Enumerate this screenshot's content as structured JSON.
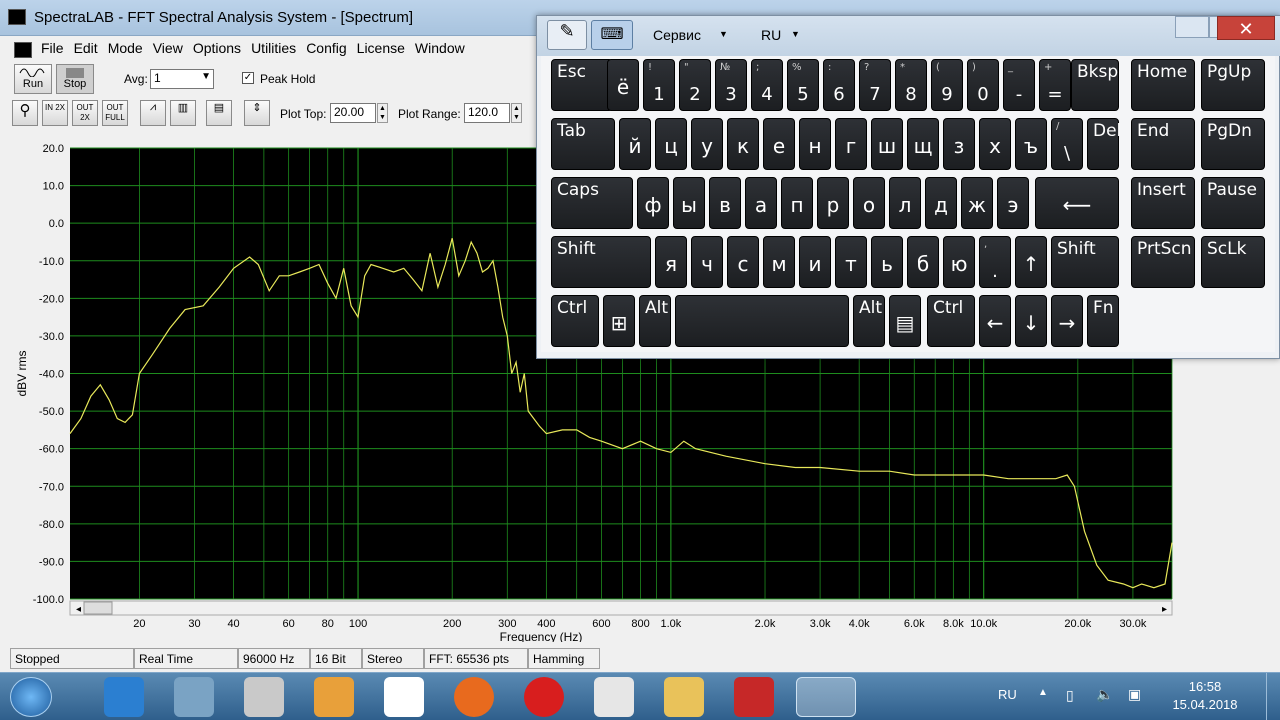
{
  "window": {
    "title": "SpectraLAB - FFT Spectral Analysis System - [Spectrum]"
  },
  "menu": [
    "File",
    "Edit",
    "Mode",
    "View",
    "Options",
    "Utilities",
    "Config",
    "License",
    "Window"
  ],
  "toolbar": {
    "run_label": "Run",
    "stop_label": "Stop",
    "avg_label": "Avg:",
    "avg_value": "1",
    "peak_hold_label": "Peak Hold",
    "peak_hold_checked": true,
    "zoom_in_label": "IN 2X",
    "zoom_out_label": "OUT 2X",
    "zoom_full_label": "OUT FULL",
    "plot_top_label": "Plot Top:",
    "plot_top_value": "20.00",
    "plot_range_label": "Plot Range:",
    "plot_range_value": "120.0"
  },
  "chart_data": {
    "type": "line",
    "xlabel": "Frequency (Hz)",
    "ylabel": "dBV rms",
    "xscale": "log",
    "xlim": [
      12,
      40000
    ],
    "ylim": [
      -100,
      20
    ],
    "yticks": [
      "20.0",
      "10.0",
      "0.0",
      "-10.0",
      "-20.0",
      "-30.0",
      "-40.0",
      "-50.0",
      "-60.0",
      "-70.0",
      "-80.0",
      "-90.0",
      "-100.0"
    ],
    "xticks": [
      {
        "v": 20,
        "t": "20"
      },
      {
        "v": 30,
        "t": "30"
      },
      {
        "v": 40,
        "t": "40"
      },
      {
        "v": 60,
        "t": "60"
      },
      {
        "v": 80,
        "t": "80"
      },
      {
        "v": 100,
        "t": "100"
      },
      {
        "v": 200,
        "t": "200"
      },
      {
        "v": 300,
        "t": "300"
      },
      {
        "v": 400,
        "t": "400"
      },
      {
        "v": 600,
        "t": "600"
      },
      {
        "v": 800,
        "t": "800"
      },
      {
        "v": 1000,
        "t": "1.0k"
      },
      {
        "v": 2000,
        "t": "2.0k"
      },
      {
        "v": 3000,
        "t": "3.0k"
      },
      {
        "v": 4000,
        "t": "4.0k"
      },
      {
        "v": 6000,
        "t": "6.0k"
      },
      {
        "v": 8000,
        "t": "8.0k"
      },
      {
        "v": 10000,
        "t": "10.0k"
      },
      {
        "v": 20000,
        "t": "20.0k"
      },
      {
        "v": 30000,
        "t": "30.0k"
      }
    ],
    "grid": true,
    "colors": {
      "background": "#000000",
      "grid": "#1e8c1e",
      "trace": "#e8e85a"
    },
    "series": [
      {
        "x": [
          12,
          13,
          14,
          15,
          16,
          17,
          18,
          19,
          20,
          22,
          25,
          28,
          32,
          36,
          40,
          45,
          48,
          52,
          56,
          60,
          65,
          70,
          75,
          80,
          85,
          90,
          95,
          100,
          105,
          110,
          120,
          130,
          140,
          150,
          160,
          170,
          180,
          190,
          200,
          210,
          220,
          230,
          240,
          250,
          260,
          270,
          280,
          290,
          300,
          310,
          320,
          330,
          340,
          350,
          380,
          400,
          450,
          500,
          550,
          600,
          700,
          800,
          900,
          1000,
          1100,
          1200,
          1500,
          2000,
          2500,
          3000,
          4000,
          5000,
          6000,
          8000,
          10000,
          12000,
          15000,
          17000,
          18500,
          19500,
          21000,
          23000,
          25000,
          28000,
          30000,
          32000,
          35000,
          38000,
          40000
        ],
        "y": [
          -56,
          -52,
          -46,
          -43,
          -47,
          -52,
          -53,
          -51,
          -40,
          -35,
          -28,
          -23,
          -22,
          -17,
          -12,
          -9,
          -11,
          -18,
          -14,
          -14,
          -13,
          -12,
          -11,
          -16,
          -20,
          -12,
          -22,
          -25,
          -14,
          -11,
          -12,
          -13,
          -12,
          -15,
          -18,
          -8,
          -17,
          -11,
          -4,
          -14,
          -10,
          -5,
          -8,
          -13,
          -12,
          -10,
          -17,
          -25,
          -30,
          -40,
          -37,
          -45,
          -40,
          -50,
          -54,
          -56,
          -55,
          -55,
          -57,
          -58,
          -60,
          -58,
          -60,
          -61,
          -58,
          -60,
          -62,
          -64,
          -65,
          -65,
          -66,
          -66,
          -67,
          -67,
          -67,
          -68,
          -68,
          -68,
          -67,
          -70,
          -82,
          -91,
          -95,
          -96,
          -97,
          -96,
          -97,
          -96,
          -85
        ]
      }
    ]
  },
  "status": [
    "Stopped",
    "Real Time",
    "96000 Hz",
    "16 Bit",
    "Stereo",
    "FFT: 65536 pts",
    "Hamming"
  ],
  "osk": {
    "servis": "Сервис",
    "lang": "RU",
    "close": "✕",
    "keys": [
      {
        "m": "Esc"
      },
      {
        "m": "ё"
      },
      {
        "s": "!",
        "b": "1"
      },
      {
        "s": "\"",
        "b": "2"
      },
      {
        "s": "№",
        "b": "3"
      },
      {
        "s": ";",
        "b": "4"
      },
      {
        "s": "%",
        "b": "5"
      },
      {
        "s": ":",
        "b": "6"
      },
      {
        "s": "?",
        "b": "7"
      },
      {
        "s": "*",
        "b": "8"
      },
      {
        "s": "(",
        "b": "9"
      },
      {
        "s": ")",
        "b": "0"
      },
      {
        "s": "_",
        "b": "-"
      },
      {
        "s": "+",
        "b": "="
      },
      {
        "m": "Bksp"
      },
      {
        "m": "Home"
      },
      {
        "m": "PgUp"
      },
      {
        "m": "Tab"
      },
      {
        "m": "й"
      },
      {
        "m": "ц"
      },
      {
        "m": "у"
      },
      {
        "m": "к"
      },
      {
        "m": "е"
      },
      {
        "m": "н"
      },
      {
        "m": "г"
      },
      {
        "m": "ш"
      },
      {
        "m": "щ"
      },
      {
        "m": "з"
      },
      {
        "m": "х"
      },
      {
        "m": "ъ"
      },
      {
        "s": "/",
        "b": "\\"
      },
      {
        "m": "Del"
      },
      {
        "m": "End"
      },
      {
        "m": "PgDn"
      },
      {
        "m": "Caps"
      },
      {
        "m": "ф"
      },
      {
        "m": "ы"
      },
      {
        "m": "в"
      },
      {
        "m": "а"
      },
      {
        "m": "п"
      },
      {
        "m": "р"
      },
      {
        "m": "о"
      },
      {
        "m": "л"
      },
      {
        "m": "д"
      },
      {
        "m": "ж"
      },
      {
        "m": "э"
      },
      {
        "m": "⟵"
      },
      {
        "m": "Insert"
      },
      {
        "m": "Pause"
      },
      {
        "m": "Shift"
      },
      {
        "m": "я"
      },
      {
        "m": "ч"
      },
      {
        "m": "с"
      },
      {
        "m": "м"
      },
      {
        "m": "и"
      },
      {
        "m": "т"
      },
      {
        "m": "ь"
      },
      {
        "m": "б"
      },
      {
        "m": "ю"
      },
      {
        "s": ",",
        "b": "."
      },
      {
        "m": "↑"
      },
      {
        "m": "Shift"
      },
      {
        "m": "PrtScn"
      },
      {
        "m": "ScLk"
      },
      {
        "m": "Ctrl"
      },
      {
        "m": "⊞"
      },
      {
        "m": "Alt"
      },
      {
        "m": ""
      },
      {
        "m": "Alt"
      },
      {
        "m": "▤"
      },
      {
        "m": "Ctrl"
      },
      {
        "m": "←"
      },
      {
        "m": "↓"
      },
      {
        "m": "→"
      },
      {
        "m": "Fn"
      }
    ]
  },
  "taskbar": {
    "lang": "RU",
    "time": "16:58",
    "date": "15.04.2018"
  }
}
